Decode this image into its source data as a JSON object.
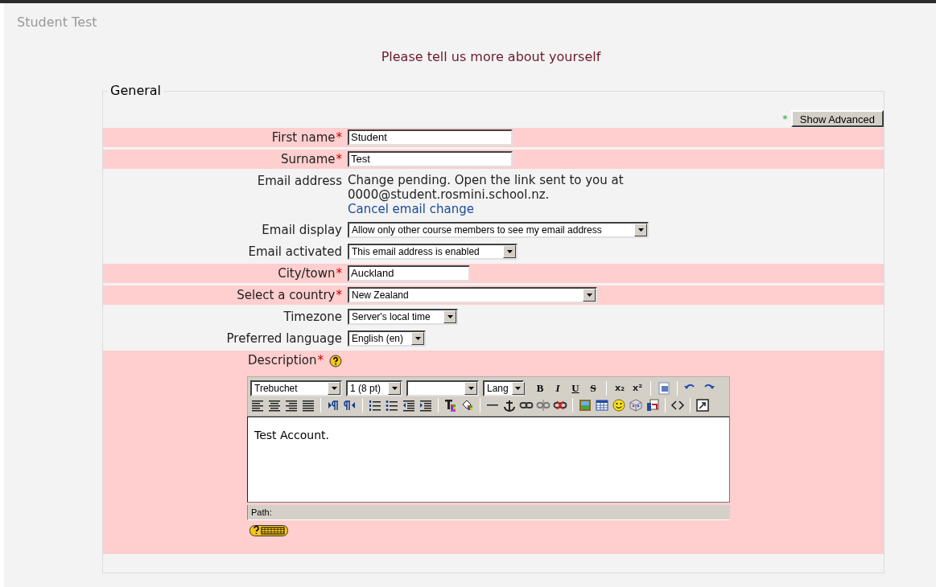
{
  "page_title": "Student Test",
  "heading": "Please tell us more about yourself",
  "required_mark": "*",
  "fieldset": {
    "legend": "General",
    "advanced_marker": "*",
    "advanced_button": "Show Advanced"
  },
  "fields": [
    {
      "kind": "input",
      "label": "First name",
      "required": true,
      "value": "Student"
    },
    {
      "kind": "input",
      "label": "Surname",
      "required": true,
      "value": "Test"
    },
    {
      "kind": "text",
      "label": "Email address",
      "required": false,
      "text": "Change pending. Open the link sent to you at 0000@student.rosmini.school.nz.",
      "link": "Cancel email change"
    },
    {
      "kind": "select",
      "label": "Email display",
      "required": false,
      "value": "Allow only other course members to see my email address"
    },
    {
      "kind": "select",
      "label": "Email activated",
      "required": false,
      "value": "This email address is enabled"
    },
    {
      "kind": "input",
      "label": "City/town",
      "required": true,
      "value": "Auckland"
    },
    {
      "kind": "select",
      "label": "Select a country",
      "required": true,
      "value": "New Zealand"
    },
    {
      "kind": "select",
      "label": "Timezone",
      "required": false,
      "value": "Server's local time"
    },
    {
      "kind": "select",
      "label": "Preferred language",
      "required": false,
      "value": "English (en)"
    },
    {
      "kind": "editor",
      "label": "Description",
      "required": true,
      "help": true
    }
  ],
  "editor": {
    "font": "Trebuchet",
    "size": "1 (8 pt)",
    "lang": "Lang",
    "format_buttons": [
      "B",
      "I",
      "U",
      "S"
    ],
    "script_buttons": [
      "x₂",
      "x²"
    ],
    "content": "Test Account.",
    "path_label": "Path:"
  }
}
